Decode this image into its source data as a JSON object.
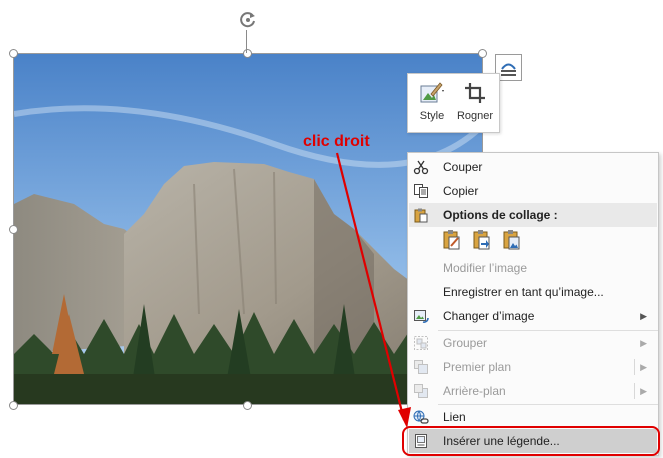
{
  "toolbar": {
    "style_label": "Style",
    "crop_label": "Rogner",
    "icons": [
      "picture-style-icon",
      "crop-icon"
    ]
  },
  "annotation": {
    "label": "clic droit",
    "color": "#e00000"
  },
  "context_menu": {
    "items": [
      {
        "label": "Couper",
        "icon": "scissors-icon",
        "enabled": true
      },
      {
        "label": "Copier",
        "icon": "copy-icon",
        "enabled": true
      },
      {
        "label": "Options de collage :",
        "icon": "clipboard-icon",
        "enabled": true,
        "header": true
      },
      {
        "label": "Modifier l’image",
        "enabled": false
      },
      {
        "label": "Enregistrer en tant qu’image...",
        "enabled": true
      },
      {
        "label": "Changer d’image",
        "icon": "change-picture-icon",
        "enabled": true,
        "submenu": true
      },
      {
        "label": "Grouper",
        "icon": "group-icon",
        "enabled": false,
        "submenu": true
      },
      {
        "label": "Premier plan",
        "icon": "bring-forward-icon",
        "enabled": false,
        "submenu": true
      },
      {
        "label": "Arrière-plan",
        "icon": "send-backward-icon",
        "enabled": false,
        "submenu": true
      },
      {
        "label": "Lien",
        "icon": "link-icon",
        "enabled": true
      },
      {
        "label": "Insérer une légende...",
        "icon": "caption-icon",
        "enabled": true,
        "highlighted": true
      }
    ],
    "paste_options": [
      "paste-keep-formatting-icon",
      "paste-merge-icon",
      "paste-picture-icon"
    ]
  },
  "colors": {
    "accent_red": "#e00000",
    "menu_highlight": "#cfcfcf"
  }
}
